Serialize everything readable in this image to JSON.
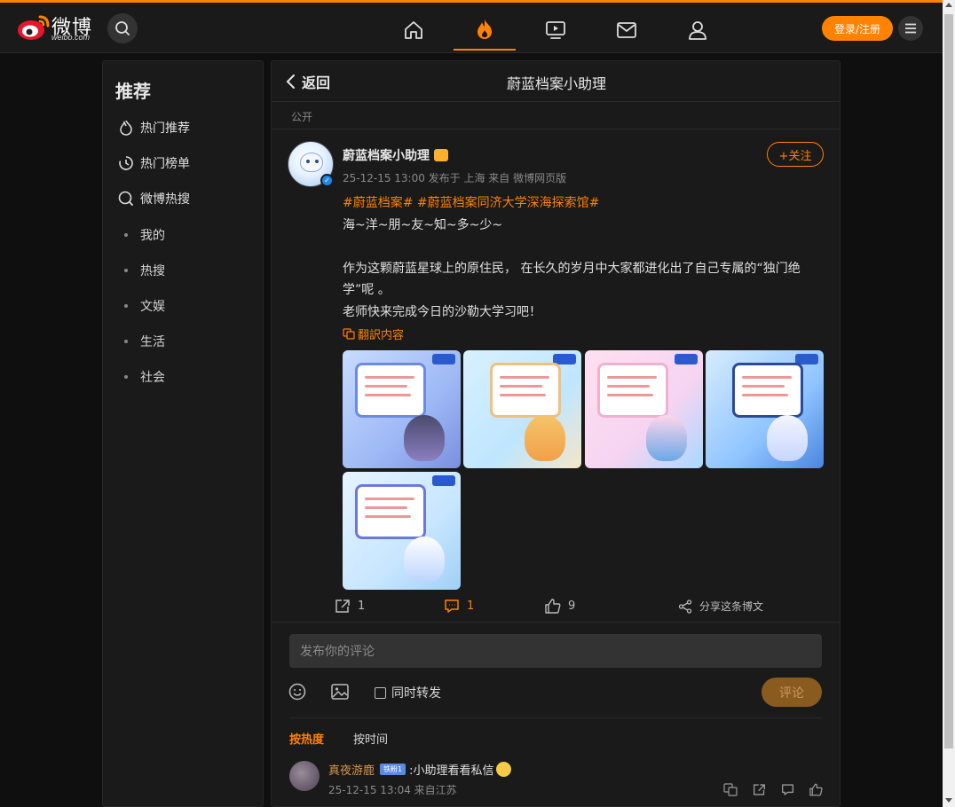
{
  "brand": {
    "logo_text": "微博",
    "logo_sub": "weibo.com"
  },
  "header": {
    "login_label": "登录/注册"
  },
  "sidebar": {
    "title": "推荐",
    "main_items": [
      {
        "label": "热门推荐",
        "icon": "flame-icon"
      },
      {
        "label": "热门榜单",
        "icon": "chart-icon"
      },
      {
        "label": "微博热搜",
        "icon": "search-icon"
      }
    ],
    "sub_items": [
      "我的",
      "热搜",
      "文娱",
      "生活",
      "社会"
    ]
  },
  "page": {
    "back_label": "返回",
    "title": "蔚蓝档案小助理",
    "visibility": "公开"
  },
  "post": {
    "author": "蔚蓝档案小助理",
    "meta": "25-12-15 13:00 发布于 上海  来自 微博网页版",
    "follow_label": "+关注",
    "tag1": "#蔚蓝档案#",
    "tag2": "#蔚蓝档案同济大学深海探索馆#",
    "line1": "海~洋~朋~友~知~多~少~",
    "line2": "作为这颗蔚蓝星球上的原住民， 在长久的岁月中大家都进化出了自己专属的“独门绝学”呢 。",
    "line3": "老师快来完成今日的沙勒大学习吧！",
    "translate_label": "翻訳内容",
    "reposts": "1",
    "comments": "1",
    "likes": "9",
    "share_label": "分享这条博文"
  },
  "composer": {
    "placeholder": "发布你的评论",
    "repost_label": "同时转发",
    "submit_label": "评论"
  },
  "sort": {
    "hot": "按热度",
    "time": "按时间"
  },
  "comment": {
    "user": "真夜游鹿",
    "badge": "铁粉1",
    "text": ":小助理看看私信",
    "meta": "25-12-15 13:04 来自江苏"
  },
  "colors": {
    "accent": "#ff8200",
    "background": "#0f0f0f",
    "panel": "#1a1a1a"
  }
}
